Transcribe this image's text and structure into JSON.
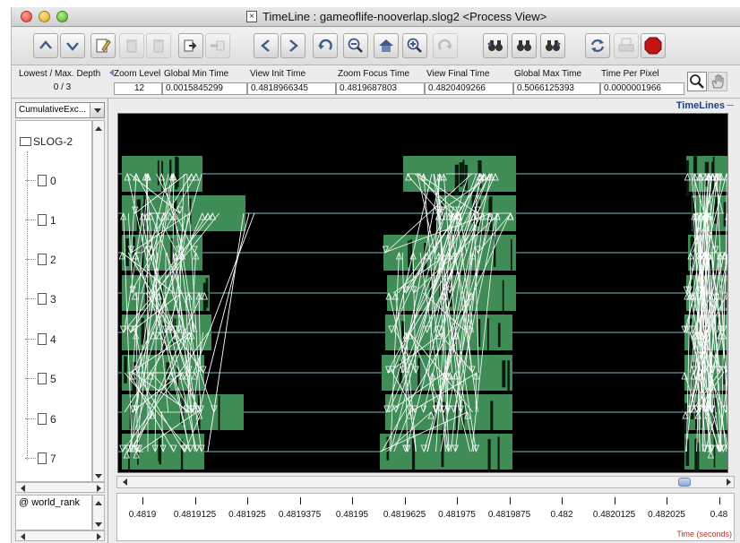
{
  "window": {
    "title": "TimeLine : gameoflife-nooverlap.slog2  <Process View>"
  },
  "toolbar": {
    "buttons": [
      {
        "name": "scroll-up-button",
        "icon": "chevron-up-icon"
      },
      {
        "name": "scroll-down-button",
        "icon": "chevron-down-icon"
      },
      {
        "name": "edit-button",
        "icon": "pencil-icon"
      },
      {
        "name": "delete-button",
        "icon": "trash-icon"
      },
      {
        "name": "delete-all-button",
        "icon": "trash-icon"
      },
      {
        "name": "export-button",
        "icon": "export-icon"
      },
      {
        "name": "import-button",
        "icon": "import-icon"
      },
      {
        "name": "back-button",
        "icon": "chevron-left-icon"
      },
      {
        "name": "forward-button",
        "icon": "chevron-right-icon"
      },
      {
        "name": "undo-button",
        "icon": "undo-icon"
      },
      {
        "name": "zoom-out-button",
        "icon": "zoom-out-icon"
      },
      {
        "name": "home-button",
        "icon": "home-icon"
      },
      {
        "name": "zoom-in-button",
        "icon": "zoom-in-icon"
      },
      {
        "name": "redo-button",
        "icon": "redo-icon"
      },
      {
        "name": "search-backward-button",
        "icon": "binoculars-icon"
      },
      {
        "name": "search-init-button",
        "icon": "binoculars-icon"
      },
      {
        "name": "search-forward-button",
        "icon": "binoculars-icon"
      },
      {
        "name": "refresh-button",
        "icon": "refresh-icon"
      },
      {
        "name": "print-button",
        "icon": "print-icon"
      },
      {
        "name": "stop-button",
        "icon": "stop-icon"
      }
    ]
  },
  "info": {
    "depth_label": "Lowest / Max. Depth",
    "depth_value": "0 / 3",
    "zoom_level_label": "Zoom Level",
    "zoom_level_value": "12",
    "global_min_label": "Global Min Time",
    "global_min_value": "0.0015845299",
    "view_init_label": "View  Init Time",
    "view_init_value": "0.4818966345",
    "zoom_focus_label": "Zoom Focus Time",
    "zoom_focus_value": "0.4819687803",
    "view_final_label": "View Final Time",
    "view_final_value": "0.4820409266",
    "global_max_label": "Global Max Time",
    "global_max_value": "0.5066125393",
    "time_per_pixel_label": "Time Per Pixel",
    "time_per_pixel_value": "0.0000001966"
  },
  "left": {
    "dropdown_value": "CumulativeExc...",
    "tree_root": "SLOG-2",
    "ranks": [
      "0",
      "1",
      "2",
      "3",
      "4",
      "5",
      "6",
      "7"
    ],
    "legend_value": "@ world_rank"
  },
  "canvas": {
    "title": "TimeLines",
    "background_color": "#000000",
    "state_color": "#3f8c57",
    "timeline_color": "#7fbcc4",
    "arrow_color": "#ffffff"
  },
  "axis": {
    "ticks": [
      "0.4819",
      "0.4819125",
      "0.481925",
      "0.4819375",
      "0.48195",
      "0.4819625",
      "0.481975",
      "0.4819875",
      "0.482",
      "0.4820125",
      "0.482025",
      "0.48"
    ],
    "title": "Time (seconds)"
  }
}
